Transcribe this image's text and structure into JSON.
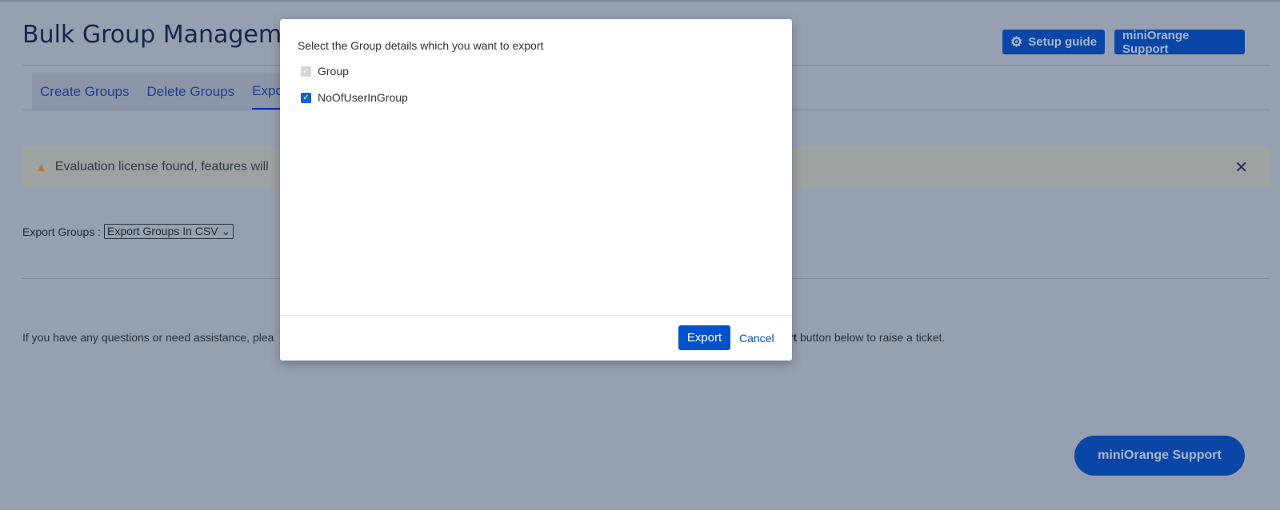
{
  "header": {
    "title": "Bulk Group Managemen",
    "setup_label": "Setup guide",
    "support_label": "miniOrange Support"
  },
  "tabs": [
    {
      "label": "Create Groups"
    },
    {
      "label": "Delete Groups"
    },
    {
      "label": "Expo"
    }
  ],
  "alert": {
    "text": "Evaluation license found, features will",
    "icon": "warning-icon",
    "close": "✕"
  },
  "export": {
    "label": "Export Groups :",
    "selected": "Export Groups In CSV"
  },
  "help": {
    "left": "If you have any questions or need assistance, plea",
    "bold": "rt",
    "right": " button below to raise a ticket."
  },
  "fab_label": "miniOrange Support",
  "modal": {
    "title": "Select the Group details which you want to export",
    "options": [
      {
        "label": "Group",
        "checked": true,
        "disabled": true
      },
      {
        "label": "NoOfUserInGroup",
        "checked": true,
        "disabled": false
      }
    ],
    "export_label": "Export",
    "cancel_label": "Cancel"
  },
  "colors": {
    "primary": "#0052cc",
    "overlay": "#97a0b0"
  }
}
